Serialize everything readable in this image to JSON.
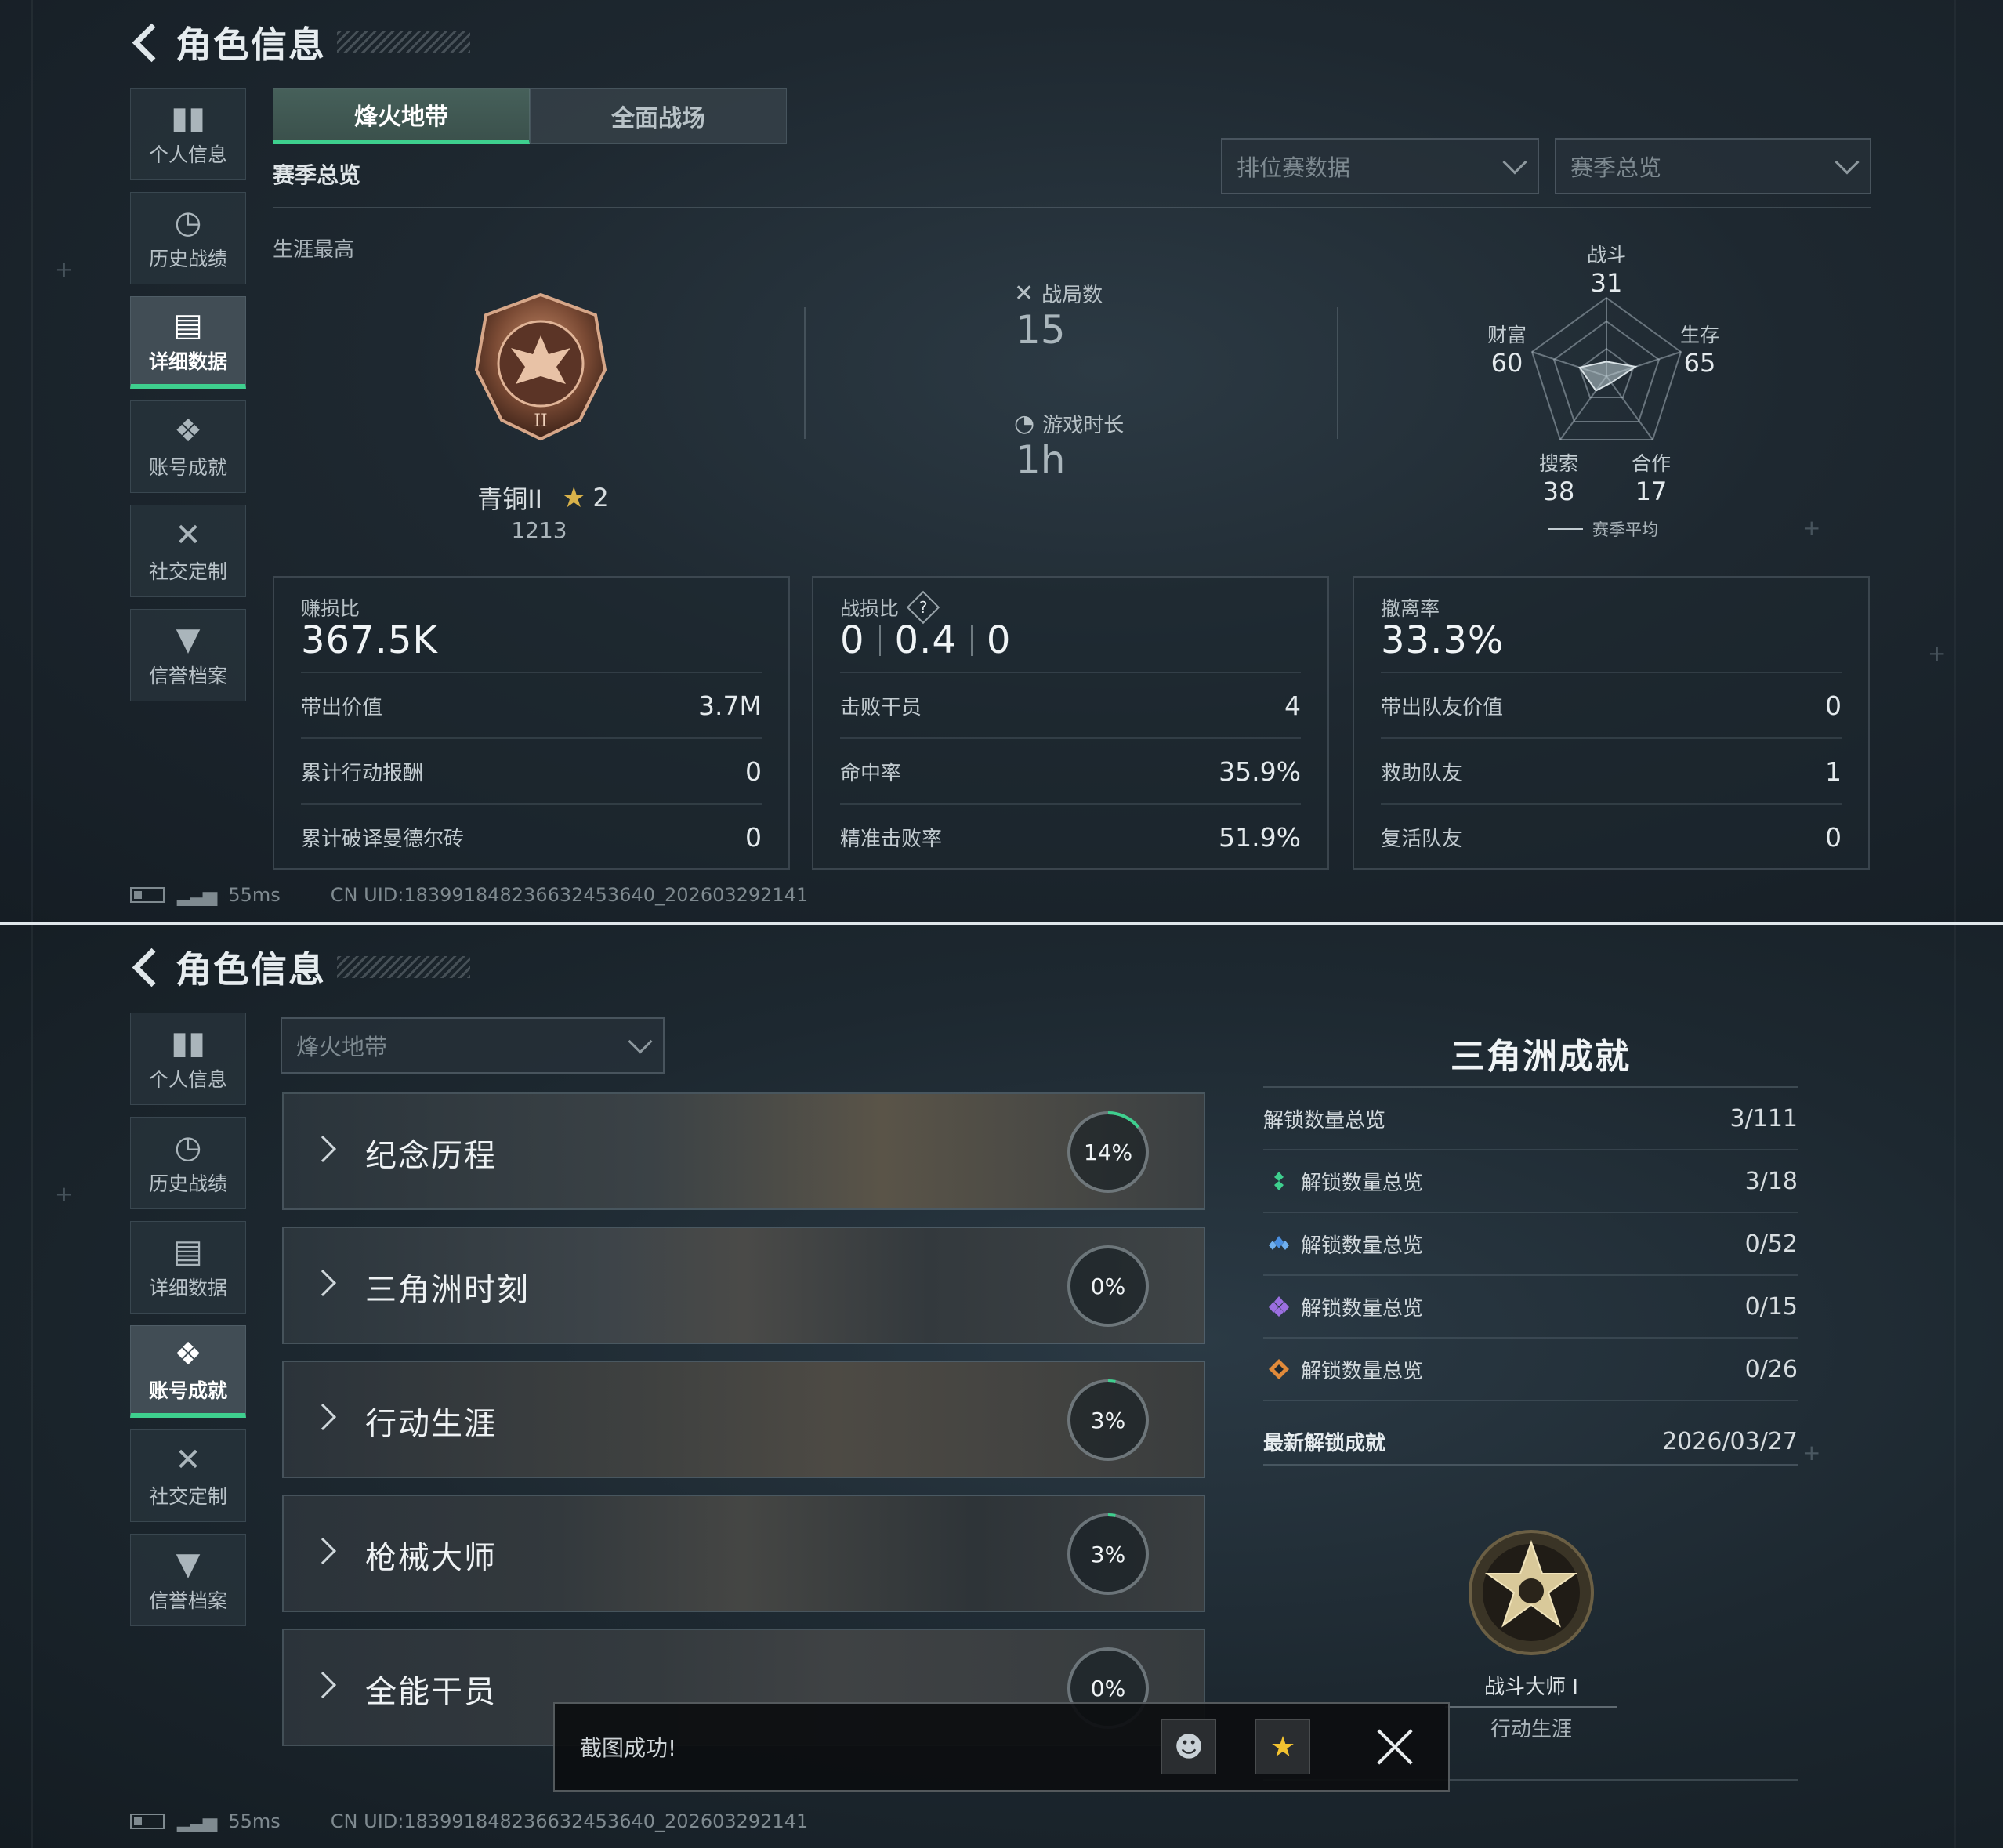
{
  "top": {
    "title": "角色信息",
    "nav": [
      {
        "label": "个人信息",
        "icon": "bar-chart-icon"
      },
      {
        "label": "历史战绩",
        "icon": "clock-icon"
      },
      {
        "label": "详细数据",
        "icon": "folder-icon",
        "active": true
      },
      {
        "label": "账号成就",
        "icon": "badge-icon"
      },
      {
        "label": "社交定制",
        "icon": "tools-icon"
      },
      {
        "label": "信誉档案",
        "icon": "shield-icon"
      }
    ],
    "modes": [
      "烽火地带",
      "全面战场"
    ],
    "active_mode": 0,
    "section_label": "赛季总览",
    "dropdown1": "排位赛数据",
    "dropdown2": "赛季总览",
    "career_label": "生涯最高",
    "rank_name": "青铜II",
    "rank_stars": "2",
    "rank_score": "1213",
    "matches_label": "战局数",
    "matches_value": "15",
    "playtime_label": "游戏时长",
    "playtime_value": "1h",
    "radar": {
      "labels": {
        "top": "战斗",
        "right": "生存",
        "left": "财富",
        "bottom_left": "搜索",
        "bottom_right": "合作"
      },
      "values": {
        "top": "31",
        "right": "65",
        "left": "60",
        "bottom_left": "38",
        "bottom_right": "17"
      },
      "legend": "赛季平均"
    },
    "boxes": [
      {
        "label": "赚损比",
        "value": "367.5K",
        "rows": [
          {
            "k": "带出价值",
            "v": "3.7M"
          },
          {
            "k": "累计行动报酬",
            "v": "0"
          },
          {
            "k": "累计破译曼德尔砖",
            "v": "0"
          }
        ]
      },
      {
        "label": "战损比",
        "value_parts": [
          "0",
          "0.4",
          "0"
        ],
        "help": "?",
        "rows": [
          {
            "k": "击败干员",
            "v": "4"
          },
          {
            "k": "命中率",
            "v": "35.9%"
          },
          {
            "k": "精准击败率",
            "v": "51.9%"
          }
        ]
      },
      {
        "label": "撤离率",
        "value": "33.3%",
        "rows": [
          {
            "k": "带出队友价值",
            "v": "0"
          },
          {
            "k": "救助队友",
            "v": "1"
          },
          {
            "k": "复活队友",
            "v": "0"
          }
        ]
      }
    ],
    "ping": "55ms",
    "uid": "CN UID:1839918482366324536​40_202603292141"
  },
  "bottom": {
    "title": "角色信息",
    "nav": [
      {
        "label": "个人信息",
        "icon": "bar-chart-icon"
      },
      {
        "label": "历史战绩",
        "icon": "clock-icon"
      },
      {
        "label": "详细数据",
        "icon": "folder-icon"
      },
      {
        "label": "账号成就",
        "icon": "badge-icon",
        "active": true
      },
      {
        "label": "社交定制",
        "icon": "tools-icon"
      },
      {
        "label": "信誉档案",
        "icon": "shield-icon"
      }
    ],
    "mode_select": "烽火地带",
    "categories": [
      {
        "name": "纪念历程",
        "pct": "14%",
        "progress": 0.14
      },
      {
        "name": "三角洲时刻",
        "pct": "0%",
        "progress": 0
      },
      {
        "name": "行动生涯",
        "pct": "3%",
        "progress": 0.03
      },
      {
        "name": "枪械大师",
        "pct": "3%",
        "progress": 0.03
      },
      {
        "name": "全能干员",
        "pct": "0%",
        "progress": 0
      }
    ],
    "achievements_title": "三角洲成就",
    "summary": {
      "k": "解锁数量总览",
      "v": "3/111"
    },
    "tiers": [
      {
        "k": "解锁数量总览",
        "v": "3/18",
        "color": "#3ecf8e"
      },
      {
        "k": "解锁数量总览",
        "v": "0/52",
        "color": "#4a90e2"
      },
      {
        "k": "解锁数量总览",
        "v": "0/15",
        "color": "#9b6fe0"
      },
      {
        "k": "解锁数量总览",
        "v": "0/26",
        "color": "#e08a3a"
      }
    ],
    "latest_label": "最新解锁成就",
    "latest_date": "2026/03/27",
    "latest_name": "战斗大师 I",
    "latest_category": "行动生涯",
    "toast": "截图成功!",
    "ping": "55ms",
    "uid": "CN UID:1839918482366324536​40_202603292141"
  },
  "colors": {
    "accent": "#3ecf8e",
    "bg": "#1a242c",
    "text": "#c9d1d6"
  }
}
